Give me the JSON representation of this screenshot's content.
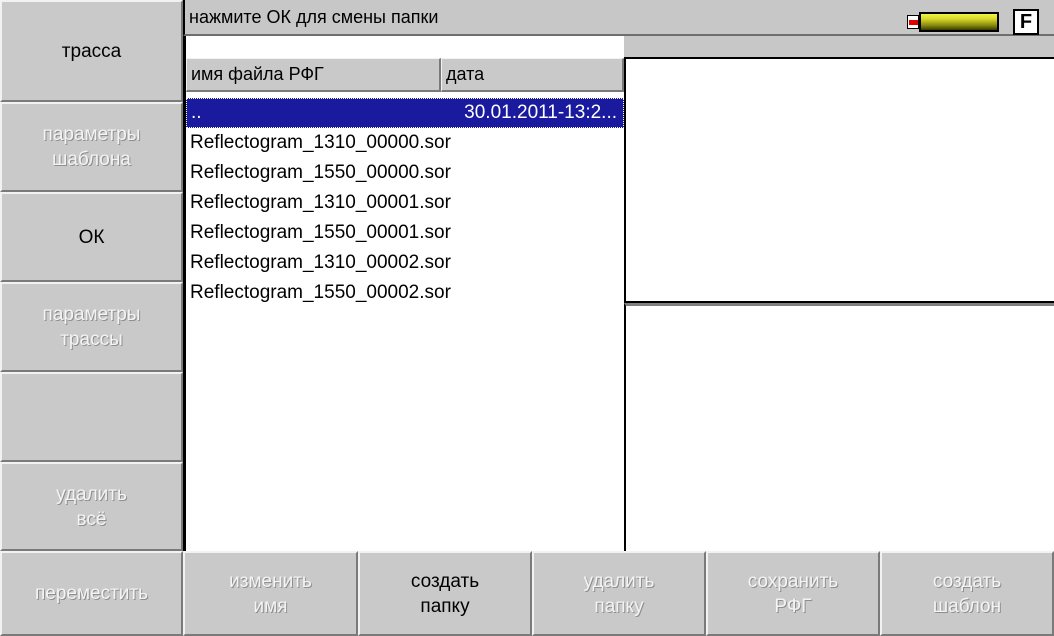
{
  "header": {
    "hint": "нажмите ОК для смены папки",
    "f_label": "F"
  },
  "columns": {
    "name": "имя файла РФГ",
    "date": "дата"
  },
  "files": [
    {
      "name": "..",
      "date": "30.01.2011-13:2..."
    },
    {
      "name": "Reflectogram_1310_00000.sor",
      "date": ""
    },
    {
      "name": "Reflectogram_1550_00000.sor",
      "date": ""
    },
    {
      "name": "Reflectogram_1310_00001.sor",
      "date": ""
    },
    {
      "name": "Reflectogram_1550_00001.sor",
      "date": ""
    },
    {
      "name": "Reflectogram_1310_00002.sor",
      "date": ""
    },
    {
      "name": "Reflectogram_1550_00002.sor",
      "date": ""
    }
  ],
  "sidebar": {
    "trace": "трасса",
    "template_params": "параметры\nшаблона",
    "ok": "ОК",
    "trace_params": "параметры\nтрассы",
    "empty": "",
    "delete_all": "удалить\nвсё"
  },
  "bottom": {
    "move": "переместить",
    "rename": "изменить\nимя",
    "create_folder": "создать\nпапку",
    "delete_folder": "удалить\nпапку",
    "save_rfg": "сохранить\nРФГ",
    "create_template": "создать\nшаблон"
  },
  "colors": {
    "selection": "#1a1a9e",
    "battery_low": "#e00000",
    "battery_fill": "#d9d92a"
  }
}
